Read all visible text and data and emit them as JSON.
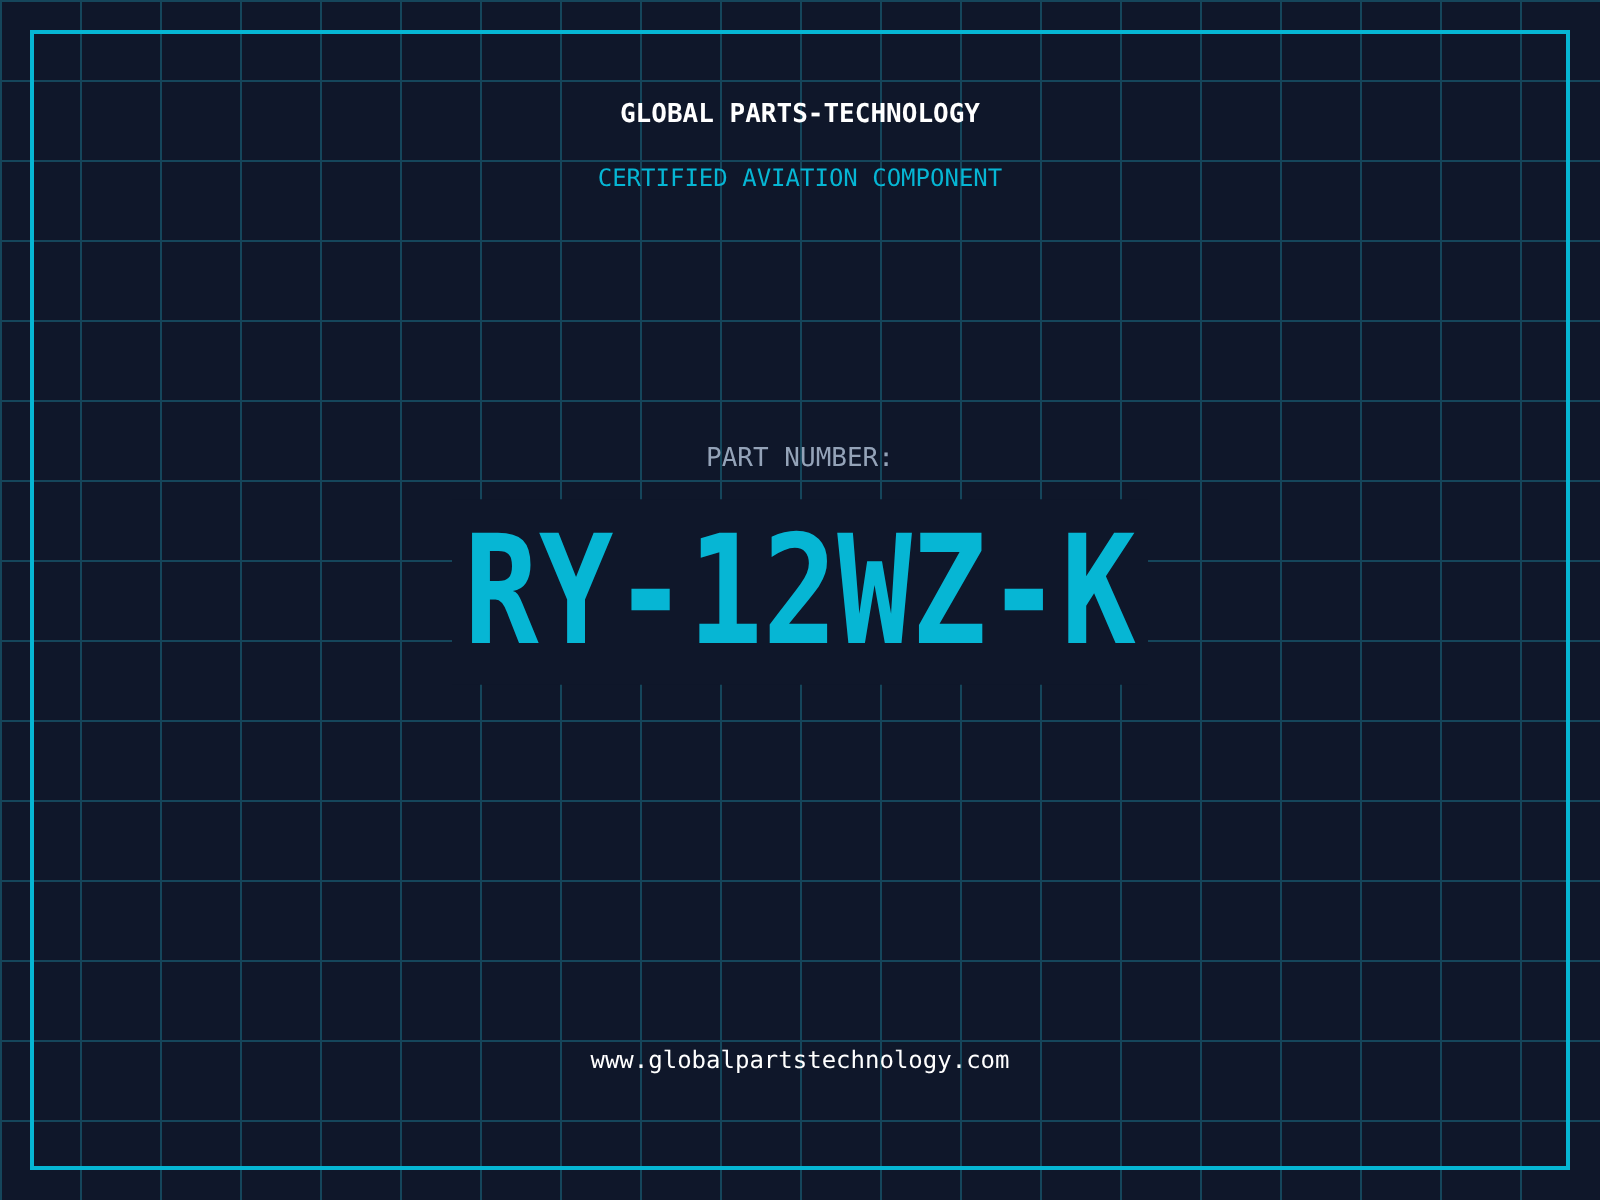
{
  "brand": {
    "title": "GLOBAL PARTS-TECHNOLOGY",
    "subtitle": "CERTIFIED AVIATION COMPONENT"
  },
  "part": {
    "label": "PART NUMBER:",
    "number": "RY-12WZ-K"
  },
  "footer": {
    "url": "www.globalpartstechnology.com"
  }
}
